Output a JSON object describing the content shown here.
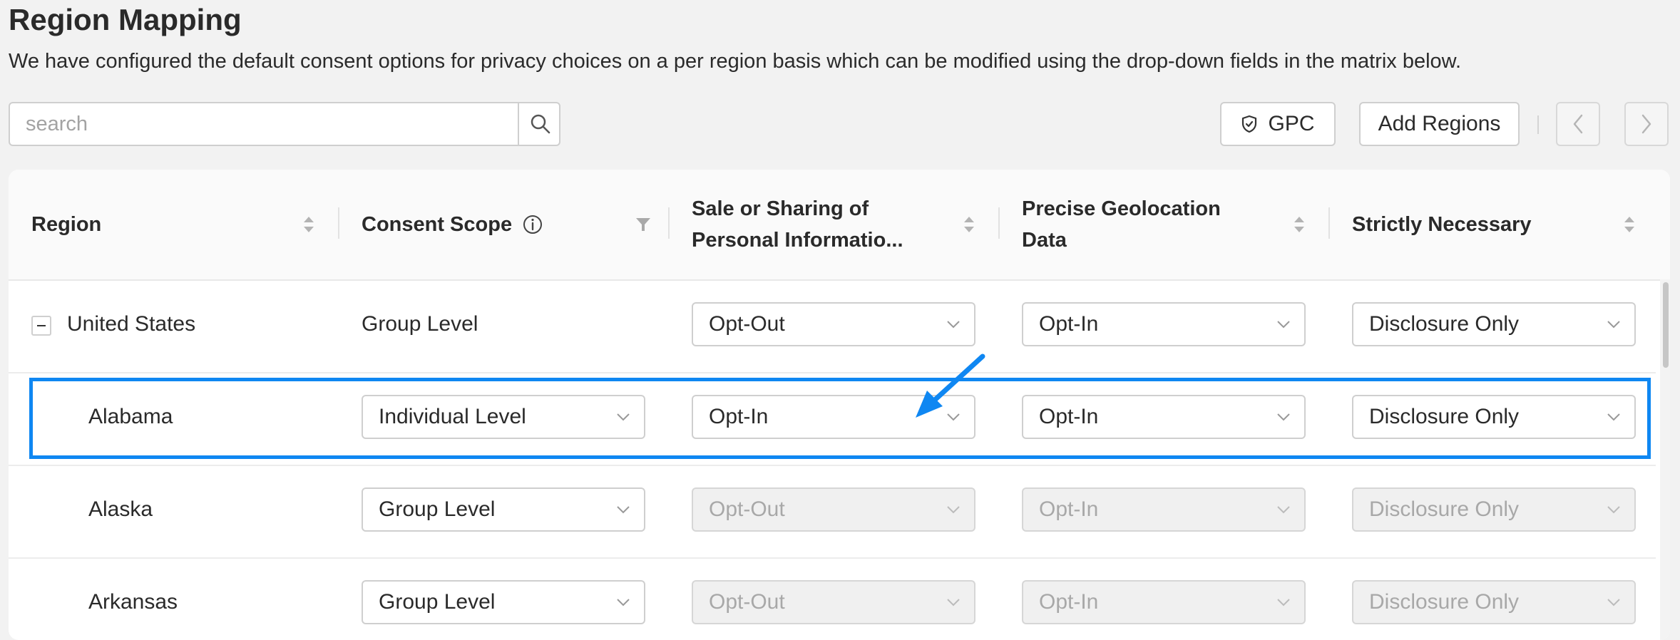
{
  "page": {
    "title": "Region Mapping",
    "description": "We have configured the default consent options for privacy choices on a per region basis which can be modified using the drop-down fields in the matrix below."
  },
  "toolbar": {
    "search_placeholder": "search",
    "search_value": "",
    "gpc_label": "GPC",
    "add_regions_label": "Add Regions"
  },
  "table": {
    "columns": [
      {
        "label": "Region"
      },
      {
        "label": "Consent Scope"
      },
      {
        "label": "Sale or Sharing of Personal Informatio..."
      },
      {
        "label": "Precise Geolocation Data"
      },
      {
        "label": "Strictly Necessary"
      }
    ],
    "rows": [
      {
        "region": "United States",
        "scope": "Group Level",
        "sale": "Opt-Out",
        "geo": "Opt-In",
        "strict": "Disclosure Only"
      },
      {
        "region": "Alabama",
        "scope": "Individual Level",
        "sale": "Opt-In",
        "geo": "Opt-In",
        "strict": "Disclosure Only"
      },
      {
        "region": "Alaska",
        "scope": "Group Level",
        "sale": "Opt-Out",
        "geo": "Opt-In",
        "strict": "Disclosure Only"
      },
      {
        "region": "Arkansas",
        "scope": "Group Level",
        "sale": "Opt-Out",
        "geo": "Opt-In",
        "strict": "Disclosure Only"
      }
    ]
  },
  "colors": {
    "highlight": "#0f87f2",
    "background": "#f2f2f2"
  },
  "icons": {
    "search": "search-icon",
    "gpc": "shield-check-icon",
    "prev": "chevron-left-icon",
    "next": "chevron-right-icon",
    "info": "info-icon",
    "filter": "filter-icon",
    "sort": "sort-icon",
    "dropdown": "chevron-down-icon",
    "collapse": "minus-square-icon"
  }
}
